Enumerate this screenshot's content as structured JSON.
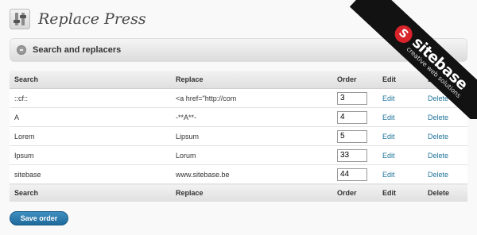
{
  "page_title": "Replace Press",
  "box_title": "Search and replacers",
  "columns": {
    "search": "Search",
    "replace": "Replace",
    "order": "Order",
    "edit": "Edit",
    "delete": "Delete"
  },
  "rows": [
    {
      "search": "::cf::",
      "replace": "<a href=\"http://com",
      "order": "3",
      "edit": "Edit",
      "delete": "Delete"
    },
    {
      "search": "A",
      "replace": "-**A**-",
      "order": "4",
      "edit": "Edit",
      "delete": "Delete"
    },
    {
      "search": "Lorem",
      "replace": "Lipsum",
      "order": "5",
      "edit": "Edit",
      "delete": "Delete"
    },
    {
      "search": "Ipsum",
      "replace": "Lorum",
      "order": "33",
      "edit": "Edit",
      "delete": "Delete"
    },
    {
      "search": "sitebase",
      "replace": "www.sitebase.be",
      "order": "44",
      "edit": "Edit",
      "delete": "Delete"
    }
  ],
  "save_button": "Save order",
  "ribbon": {
    "logo_letter": "S",
    "brand": "sitebase",
    "tagline": "creative web solutions",
    "color_bg": "#121212",
    "color_logo": "#d8232a"
  },
  "colors": {
    "link": "#21759b",
    "button": "#21759b"
  }
}
